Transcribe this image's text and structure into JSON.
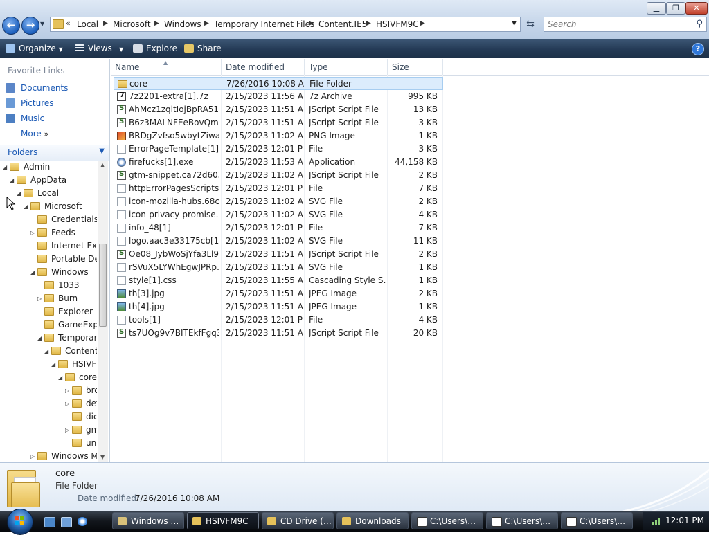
{
  "window": {
    "minimize": "▁",
    "maximize": "❐",
    "close": "✕"
  },
  "nav": {
    "back": "←",
    "forward": "→"
  },
  "address": {
    "chevrons": "«",
    "crumbs": [
      "Local",
      "Microsoft",
      "Windows",
      "Temporary Internet Files",
      "Content.IE5",
      "HSIVFM9C"
    ]
  },
  "search": {
    "placeholder": "Search"
  },
  "toolbar": {
    "organize": "Organize",
    "views": "Views",
    "explore": "Explore",
    "share": "Share",
    "help": "?"
  },
  "favorites": {
    "title": "Favorite Links",
    "items": [
      "Documents",
      "Pictures",
      "Music",
      "More"
    ]
  },
  "folders": {
    "label": "Folders",
    "tree": [
      {
        "label": "Admin",
        "arrow": "◢"
      },
      {
        "label": "AppData",
        "arrow": "◢"
      },
      {
        "label": "Local",
        "arrow": "◢"
      },
      {
        "label": "Microsoft",
        "arrow": "◢"
      },
      {
        "label": "Credentials",
        "arrow": ""
      },
      {
        "label": "Feeds",
        "arrow": "▷"
      },
      {
        "label": "Internet Explo",
        "arrow": ""
      },
      {
        "label": "Portable Devi",
        "arrow": ""
      },
      {
        "label": "Windows",
        "arrow": "◢"
      },
      {
        "label": "1033",
        "arrow": ""
      },
      {
        "label": "Burn",
        "arrow": "▷"
      },
      {
        "label": "Explorer",
        "arrow": ""
      },
      {
        "label": "GameExplo",
        "arrow": ""
      },
      {
        "label": "Temporary",
        "arrow": "◢"
      },
      {
        "label": "Content.",
        "arrow": "◢"
      },
      {
        "label": "HSIVFN",
        "arrow": "◢"
      },
      {
        "label": "core",
        "arrow": "◢"
      },
      {
        "label": "bro",
        "arrow": "▷"
      },
      {
        "label": "def",
        "arrow": "▷"
      },
      {
        "label": "dict",
        "arrow": ""
      },
      {
        "label": "gm",
        "arrow": "▷"
      },
      {
        "label": "uni",
        "arrow": ""
      },
      {
        "label": "Windows Ma",
        "arrow": "▷"
      }
    ]
  },
  "columns": {
    "name": "Name",
    "date": "Date modified",
    "type": "Type",
    "size": "Size"
  },
  "files": [
    {
      "name": "core",
      "date": "7/26/2016 10:08 AM",
      "type": "File Folder",
      "size": "",
      "icon": "folder"
    },
    {
      "name": "7z2201-extra[1].7z",
      "date": "2/15/2023 11:56 AM",
      "type": "7z Archive",
      "size": "995 KB",
      "icon": "7z"
    },
    {
      "name": "AhMcz1zqltIojBpRA51-…",
      "date": "2/15/2023 11:51 AM",
      "type": "JScript Script File",
      "size": "13 KB",
      "icon": "script"
    },
    {
      "name": "B6z3MALNFEeBovQmI…",
      "date": "2/15/2023 11:51 AM",
      "type": "JScript Script File",
      "size": "3 KB",
      "icon": "script"
    },
    {
      "name": "BRDgZvfso5wbytZiwak…",
      "date": "2/15/2023 11:02 AM",
      "type": "PNG Image",
      "size": "1 KB",
      "icon": "png"
    },
    {
      "name": "ErrorPageTemplate[1]",
      "date": "2/15/2023 12:01 PM",
      "type": "File",
      "size": "3 KB",
      "icon": "generic"
    },
    {
      "name": "firefucks[1].exe",
      "date": "2/15/2023 11:53 AM",
      "type": "Application",
      "size": "44,158 KB",
      "icon": "exe"
    },
    {
      "name": "gtm-snippet.ca72d603…",
      "date": "2/15/2023 11:02 AM",
      "type": "JScript Script File",
      "size": "2 KB",
      "icon": "script"
    },
    {
      "name": "httpErrorPagesScripts[1]",
      "date": "2/15/2023 12:01 PM",
      "type": "File",
      "size": "7 KB",
      "icon": "generic"
    },
    {
      "name": "icon-mozilla-hubs.68c…",
      "date": "2/15/2023 11:02 AM",
      "type": "SVG File",
      "size": "2 KB",
      "icon": "generic"
    },
    {
      "name": "icon-privacy-promise.…",
      "date": "2/15/2023 11:02 AM",
      "type": "SVG File",
      "size": "4 KB",
      "icon": "generic"
    },
    {
      "name": "info_48[1]",
      "date": "2/15/2023 12:01 PM",
      "type": "File",
      "size": "7 KB",
      "icon": "generic"
    },
    {
      "name": "logo.aac3e33175cb[1].…",
      "date": "2/15/2023 11:02 AM",
      "type": "SVG File",
      "size": "11 KB",
      "icon": "generic"
    },
    {
      "name": "Oe08_JybWoSjYfa3Ll9y…",
      "date": "2/15/2023 11:51 AM",
      "type": "JScript Script File",
      "size": "2 KB",
      "icon": "script"
    },
    {
      "name": "rSVuX5LYWhEgwJPRp…",
      "date": "2/15/2023 11:51 AM",
      "type": "SVG File",
      "size": "1 KB",
      "icon": "generic"
    },
    {
      "name": "style[1].css",
      "date": "2/15/2023 11:55 AM",
      "type": "Cascading Style S…",
      "size": "1 KB",
      "icon": "generic"
    },
    {
      "name": "th[3].jpg",
      "date": "2/15/2023 11:51 AM",
      "type": "JPEG Image",
      "size": "2 KB",
      "icon": "jpg"
    },
    {
      "name": "th[4].jpg",
      "date": "2/15/2023 11:51 AM",
      "type": "JPEG Image",
      "size": "1 KB",
      "icon": "jpg"
    },
    {
      "name": "tools[1]",
      "date": "2/15/2023 12:01 PM",
      "type": "File",
      "size": "4 KB",
      "icon": "generic"
    },
    {
      "name": "ts7UOg9v7BITEkfFgq3r…",
      "date": "2/15/2023 11:51 AM",
      "type": "JScript Script File",
      "size": "20 KB",
      "icon": "script"
    }
  ],
  "details": {
    "name": "core",
    "type": "File Folder",
    "date_label": "Date modified:",
    "date_value": "7/26/2016 10:08 AM"
  },
  "taskbar": {
    "buttons": [
      "Windows …",
      "HSIVFM9C",
      "CD Drive (…",
      "Downloads",
      "C:\\Users\\…",
      "C:\\Users\\…",
      "C:\\Users\\…"
    ],
    "clock": "12:01 PM"
  },
  "colors": {
    "link": "#1c5ab5",
    "selection": "#dcecfc",
    "toolbar": "#243a55"
  }
}
